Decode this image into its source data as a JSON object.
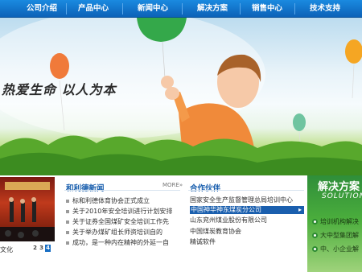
{
  "nav": {
    "items": [
      {
        "label": "公司介绍"
      },
      {
        "label": "产品中心"
      },
      {
        "label": "新闻中心"
      },
      {
        "label": "解决方案"
      },
      {
        "label": "销售中心"
      },
      {
        "label": "技术支持"
      }
    ]
  },
  "banner": {
    "slogan": "热爱生命 以人为本"
  },
  "photo": {
    "caption": "文化",
    "pages": [
      "2",
      "3",
      "4"
    ]
  },
  "news": {
    "title": "和利德新闻",
    "more": "MORE»",
    "items": [
      "标和利德体育协会正式成立",
      "关于2010年安全培训进行计划安排",
      "关于证券全国煤矿安全培训工作先",
      "关于举办煤矿组长师资培训自的",
      "成功，是一种内在精神的外延一自"
    ]
  },
  "partners": {
    "title": "合作伙伴",
    "items": [
      "国家安全生产监督管理总局培训中心",
      "中国神华神东煤炭分公司",
      "山东兖州煤业股份有限公司",
      "中国煤炭教育协会",
      "精诚软件"
    ]
  },
  "solutions": {
    "title": "解决方案",
    "subtitle": "SOLUTION",
    "items": [
      "培训机构解决",
      "大中型集团解",
      "中、小企业解"
    ]
  },
  "colors": {
    "nav": "#0c62b8",
    "accent": "#1a5fae",
    "solution_green": "#4aad3c"
  }
}
